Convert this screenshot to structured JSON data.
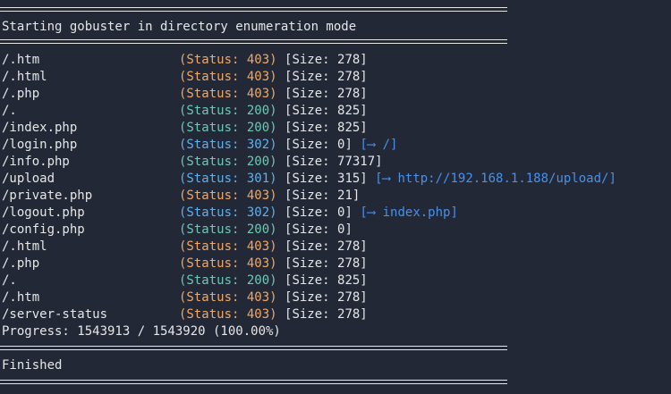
{
  "header": "Starting gobuster in directory enumeration mode",
  "colors": {
    "background": "#222836",
    "text": "#e6e6e6",
    "status_403": "#f0a868",
    "status_200": "#6ec8b4",
    "status_30x": "#62b0e8",
    "redirect": "#4a90e8"
  },
  "results": [
    {
      "path": "/.htm",
      "status": "(Status: 403)",
      "code": "403",
      "size": "[Size: 278]",
      "redirect": ""
    },
    {
      "path": "/.html",
      "status": "(Status: 403)",
      "code": "403",
      "size": "[Size: 278]",
      "redirect": ""
    },
    {
      "path": "/.php",
      "status": "(Status: 403)",
      "code": "403",
      "size": "[Size: 278]",
      "redirect": ""
    },
    {
      "path": "/.",
      "status": "(Status: 200)",
      "code": "200",
      "size": "[Size: 825]",
      "redirect": ""
    },
    {
      "path": "/index.php",
      "status": "(Status: 200)",
      "code": "200",
      "size": "[Size: 825]",
      "redirect": ""
    },
    {
      "path": "/login.php",
      "status": "(Status: 302)",
      "code": "302",
      "size": "[Size: 0]",
      "redirect": "[⟶ /]"
    },
    {
      "path": "/info.php",
      "status": "(Status: 200)",
      "code": "200",
      "size": "[Size: 77317]",
      "redirect": ""
    },
    {
      "path": "/upload",
      "status": "(Status: 301)",
      "code": "301",
      "size": "[Size: 315]",
      "redirect": "[⟶ http://192.168.1.188/upload/]"
    },
    {
      "path": "/private.php",
      "status": "(Status: 403)",
      "code": "403",
      "size": "[Size: 21]",
      "redirect": ""
    },
    {
      "path": "/logout.php",
      "status": "(Status: 302)",
      "code": "302",
      "size": "[Size: 0]",
      "redirect": "[⟶ index.php]"
    },
    {
      "path": "/config.php",
      "status": "(Status: 200)",
      "code": "200",
      "size": "[Size: 0]",
      "redirect": ""
    },
    {
      "path": "/.html",
      "status": "(Status: 403)",
      "code": "403",
      "size": "[Size: 278]",
      "redirect": ""
    },
    {
      "path": "/.php",
      "status": "(Status: 403)",
      "code": "403",
      "size": "[Size: 278]",
      "redirect": ""
    },
    {
      "path": "/.",
      "status": "(Status: 200)",
      "code": "200",
      "size": "[Size: 825]",
      "redirect": ""
    },
    {
      "path": "/.htm",
      "status": "(Status: 403)",
      "code": "403",
      "size": "[Size: 278]",
      "redirect": ""
    },
    {
      "path": "/server-status",
      "status": "(Status: 403)",
      "code": "403",
      "size": "[Size: 278]",
      "redirect": ""
    }
  ],
  "progress": "Progress: 1543913 / 1543920 (100.00%)",
  "footer": "Finished"
}
